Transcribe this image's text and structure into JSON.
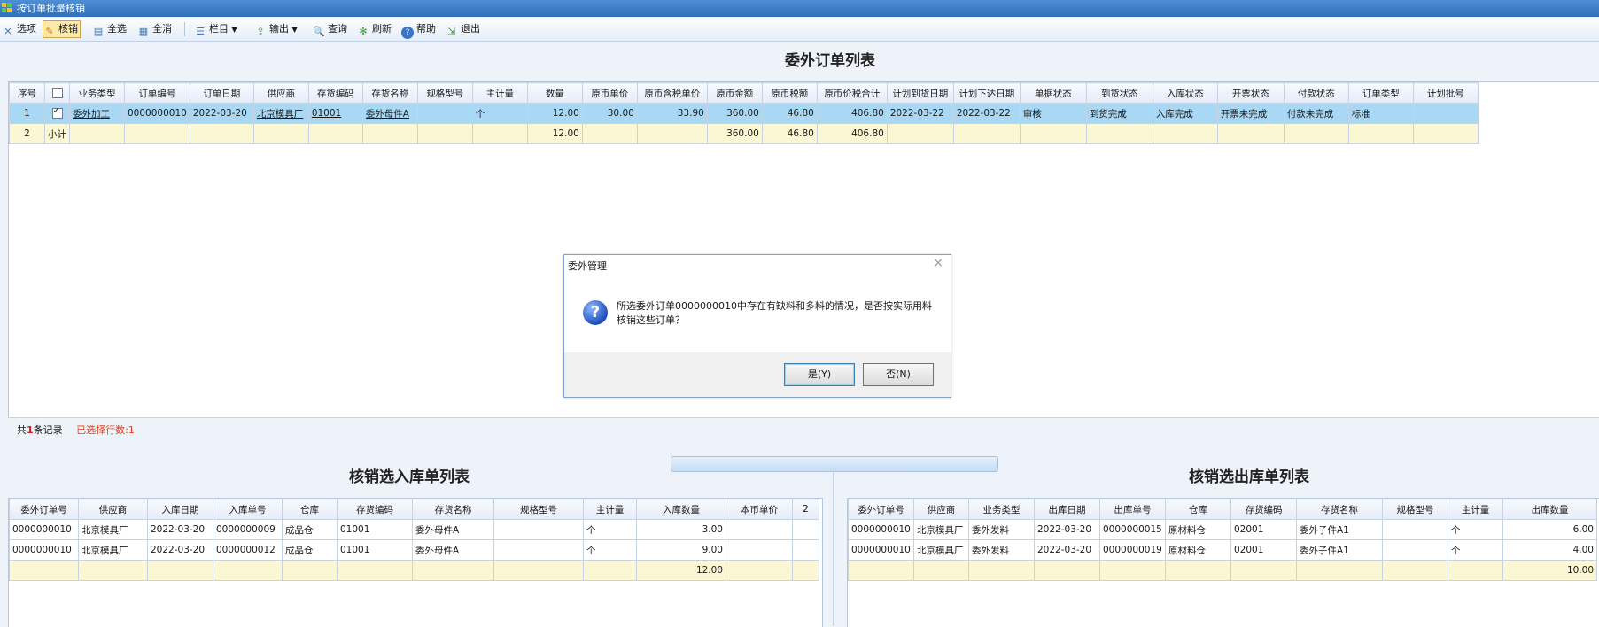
{
  "window": {
    "title": "按订单批量核销"
  },
  "toolbar": {
    "options": "选项",
    "writeoff": "核销",
    "select_all": "全选",
    "clear_all": "全消",
    "columns": "栏目",
    "output": "输出",
    "query": "查询",
    "refresh": "刷新",
    "help": "帮助",
    "exit": "退出"
  },
  "orders": {
    "title": "委外订单列表",
    "headers": [
      "序号",
      "",
      "业务类型",
      "订单编号",
      "订单日期",
      "供应商",
      "存货编码",
      "存货名称",
      "规格型号",
      "主计量",
      "数量",
      "原币单价",
      "原币含税单价",
      "原币金额",
      "原币税额",
      "原币价税合计",
      "计划到货日期",
      "计划下达日期",
      "单据状态",
      "到货状态",
      "入库状态",
      "开票状态",
      "付款状态",
      "订单类型",
      "计划批号"
    ],
    "rows": [
      [
        "1",
        "",
        "委外加工",
        "0000000010",
        "2022-03-20",
        "北京模具厂",
        "01001",
        "委外母件A",
        "",
        "个",
        "12.00",
        "30.00",
        "33.90",
        "360.00",
        "46.80",
        "406.80",
        "2022-03-22",
        "2022-03-22",
        "审核",
        "到货完成",
        "入库完成",
        "开票未完成",
        "付款未完成",
        "标准",
        ""
      ],
      [
        "2",
        "小计",
        "",
        "",
        "",
        "",
        "",
        "",
        "",
        "",
        "12.00",
        "",
        "",
        "360.00",
        "46.80",
        "406.80",
        "",
        "",
        "",
        "",
        "",
        "",
        "",
        "",
        ""
      ]
    ]
  },
  "status": {
    "total_prefix": "共",
    "total_count": "1",
    "total_suffix": "条记录",
    "selected": "已选择行数:1"
  },
  "inbound": {
    "title": "核销选入库单列表",
    "headers": [
      "委外订单号",
      "供应商",
      "入库日期",
      "入库单号",
      "仓库",
      "存货编码",
      "存货名称",
      "规格型号",
      "主计量",
      "入库数量",
      "本币单价",
      "2"
    ],
    "rows": [
      [
        "0000000010",
        "北京模具厂",
        "2022-03-20",
        "0000000009",
        "成品仓",
        "01001",
        "委外母件A",
        "",
        "个",
        "3.00",
        "",
        ""
      ],
      [
        "0000000010",
        "北京模具厂",
        "2022-03-20",
        "0000000012",
        "成品仓",
        "01001",
        "委外母件A",
        "",
        "个",
        "9.00",
        "",
        ""
      ],
      [
        "",
        "",
        "",
        "",
        "",
        "",
        "",
        "",
        "",
        "12.00",
        "",
        ""
      ]
    ]
  },
  "outbound": {
    "title": "核销选出库单列表",
    "headers": [
      "委外订单号",
      "供应商",
      "业务类型",
      "出库日期",
      "出库单号",
      "仓库",
      "存货编码",
      "存货名称",
      "规格型号",
      "主计量",
      "出库数量"
    ],
    "rows": [
      [
        "0000000010",
        "北京模具厂",
        "委外发料",
        "2022-03-20",
        "0000000015",
        "原材料仓",
        "02001",
        "委外子件A1",
        "",
        "个",
        "6.00"
      ],
      [
        "0000000010",
        "北京模具厂",
        "委外发料",
        "2022-03-20",
        "0000000019",
        "原材料仓",
        "02001",
        "委外子件A1",
        "",
        "个",
        "4.00"
      ],
      [
        "",
        "",
        "",
        "",
        "",
        "",
        "",
        "",
        "",
        "",
        "10.00"
      ]
    ]
  },
  "dialog": {
    "title": "委外管理",
    "message": "所选委外订单0000000010中存在有缺料和多料的情况，是否按实际用料核销这些订单？",
    "yes": "是(Y)",
    "no": "否(N)"
  }
}
